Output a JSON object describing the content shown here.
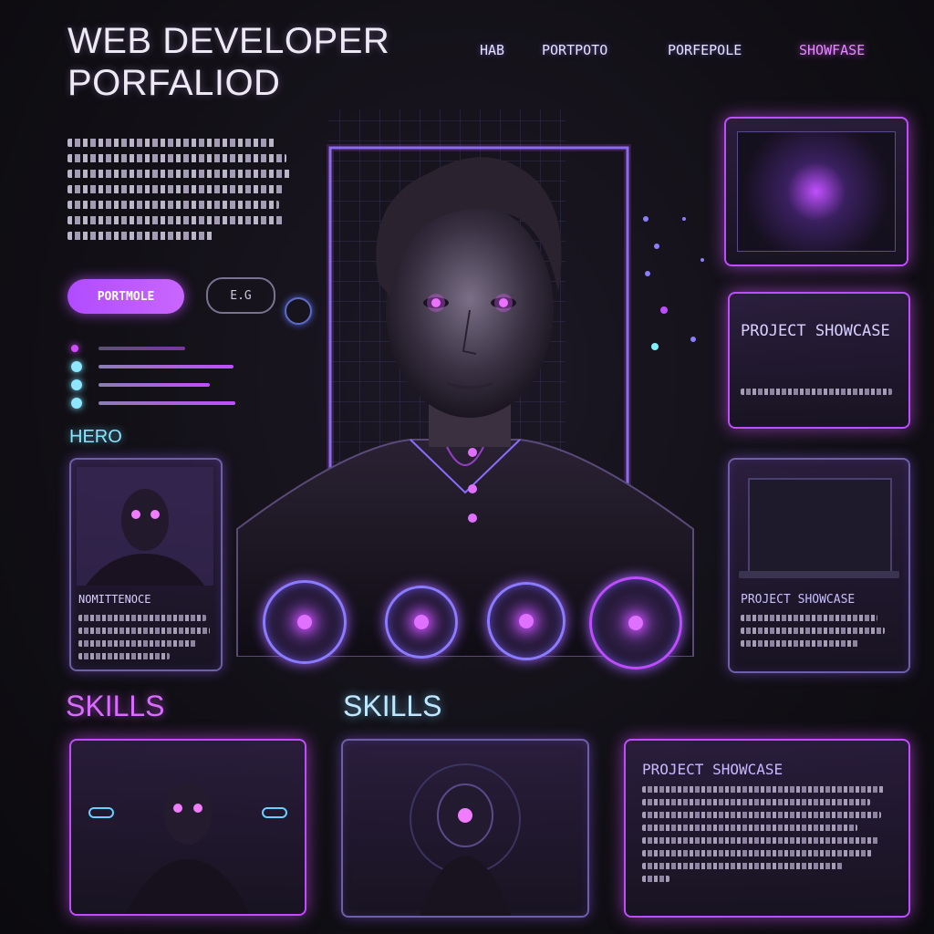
{
  "header": {
    "title_line1": "WEB DEVELOPER",
    "title_line2": "PORFALIOD"
  },
  "nav": {
    "items": [
      "HAB",
      "PORTPOTO",
      "PORFEPOLE",
      "SHOWFASE"
    ]
  },
  "hero": {
    "primary_button": "PORTMOLE",
    "secondary_button": "E.G",
    "section_label": "HERO"
  },
  "cards": {
    "left_card_title": "NOMITTENOCE",
    "right_top_title": "PROJECT SHOWCASE",
    "right_mid_title": "PROJECT SHOWCASE",
    "bottom_right_title": "PROJECT SHOWCASE"
  },
  "sections": {
    "skills_left": "SKILLS",
    "skills_center": "SKILLS"
  },
  "colors": {
    "accent_pink": "#c04cff",
    "accent_cyan": "#8ce3ff",
    "background": "#121016"
  }
}
